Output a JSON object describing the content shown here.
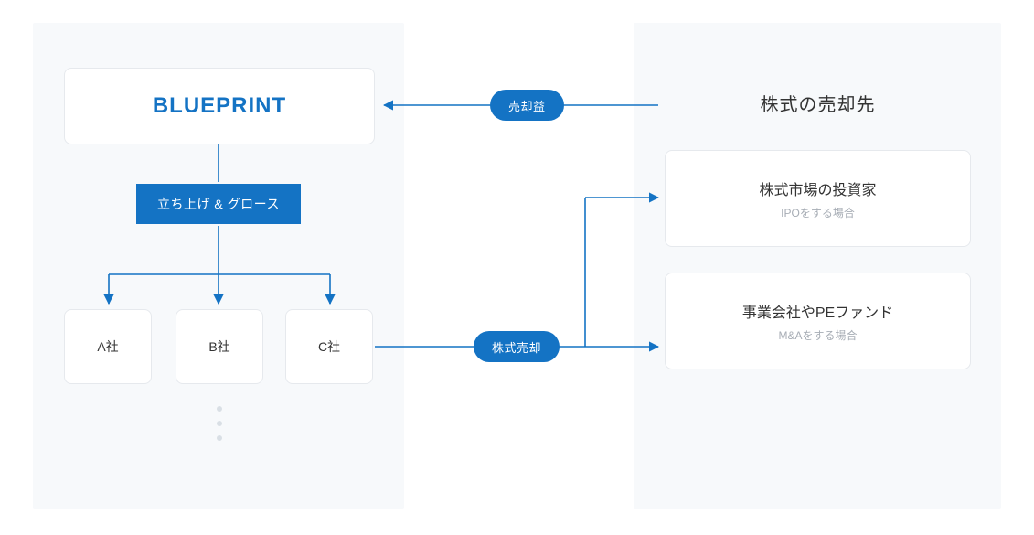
{
  "colors": {
    "accent": "#1473c4",
    "panel": "#f7f9fb",
    "card_border": "#e6e9ed",
    "muted_text": "#a7adb5"
  },
  "blueprint": {
    "logo_text": "BLUEPRINT"
  },
  "action": {
    "label": "立ち上げ & グロース"
  },
  "companies": [
    {
      "label": "A社"
    },
    {
      "label": "B社"
    },
    {
      "label": "C社"
    }
  ],
  "pills": {
    "proceeds": "売却益",
    "stock_sale": "株式売却"
  },
  "right": {
    "title": "株式の売却先",
    "destinations": [
      {
        "title": "株式市場の投資家",
        "subtitle": "IPOをする場合"
      },
      {
        "title": "事業会社やPEファンド",
        "subtitle": "M&Aをする場合"
      }
    ]
  }
}
